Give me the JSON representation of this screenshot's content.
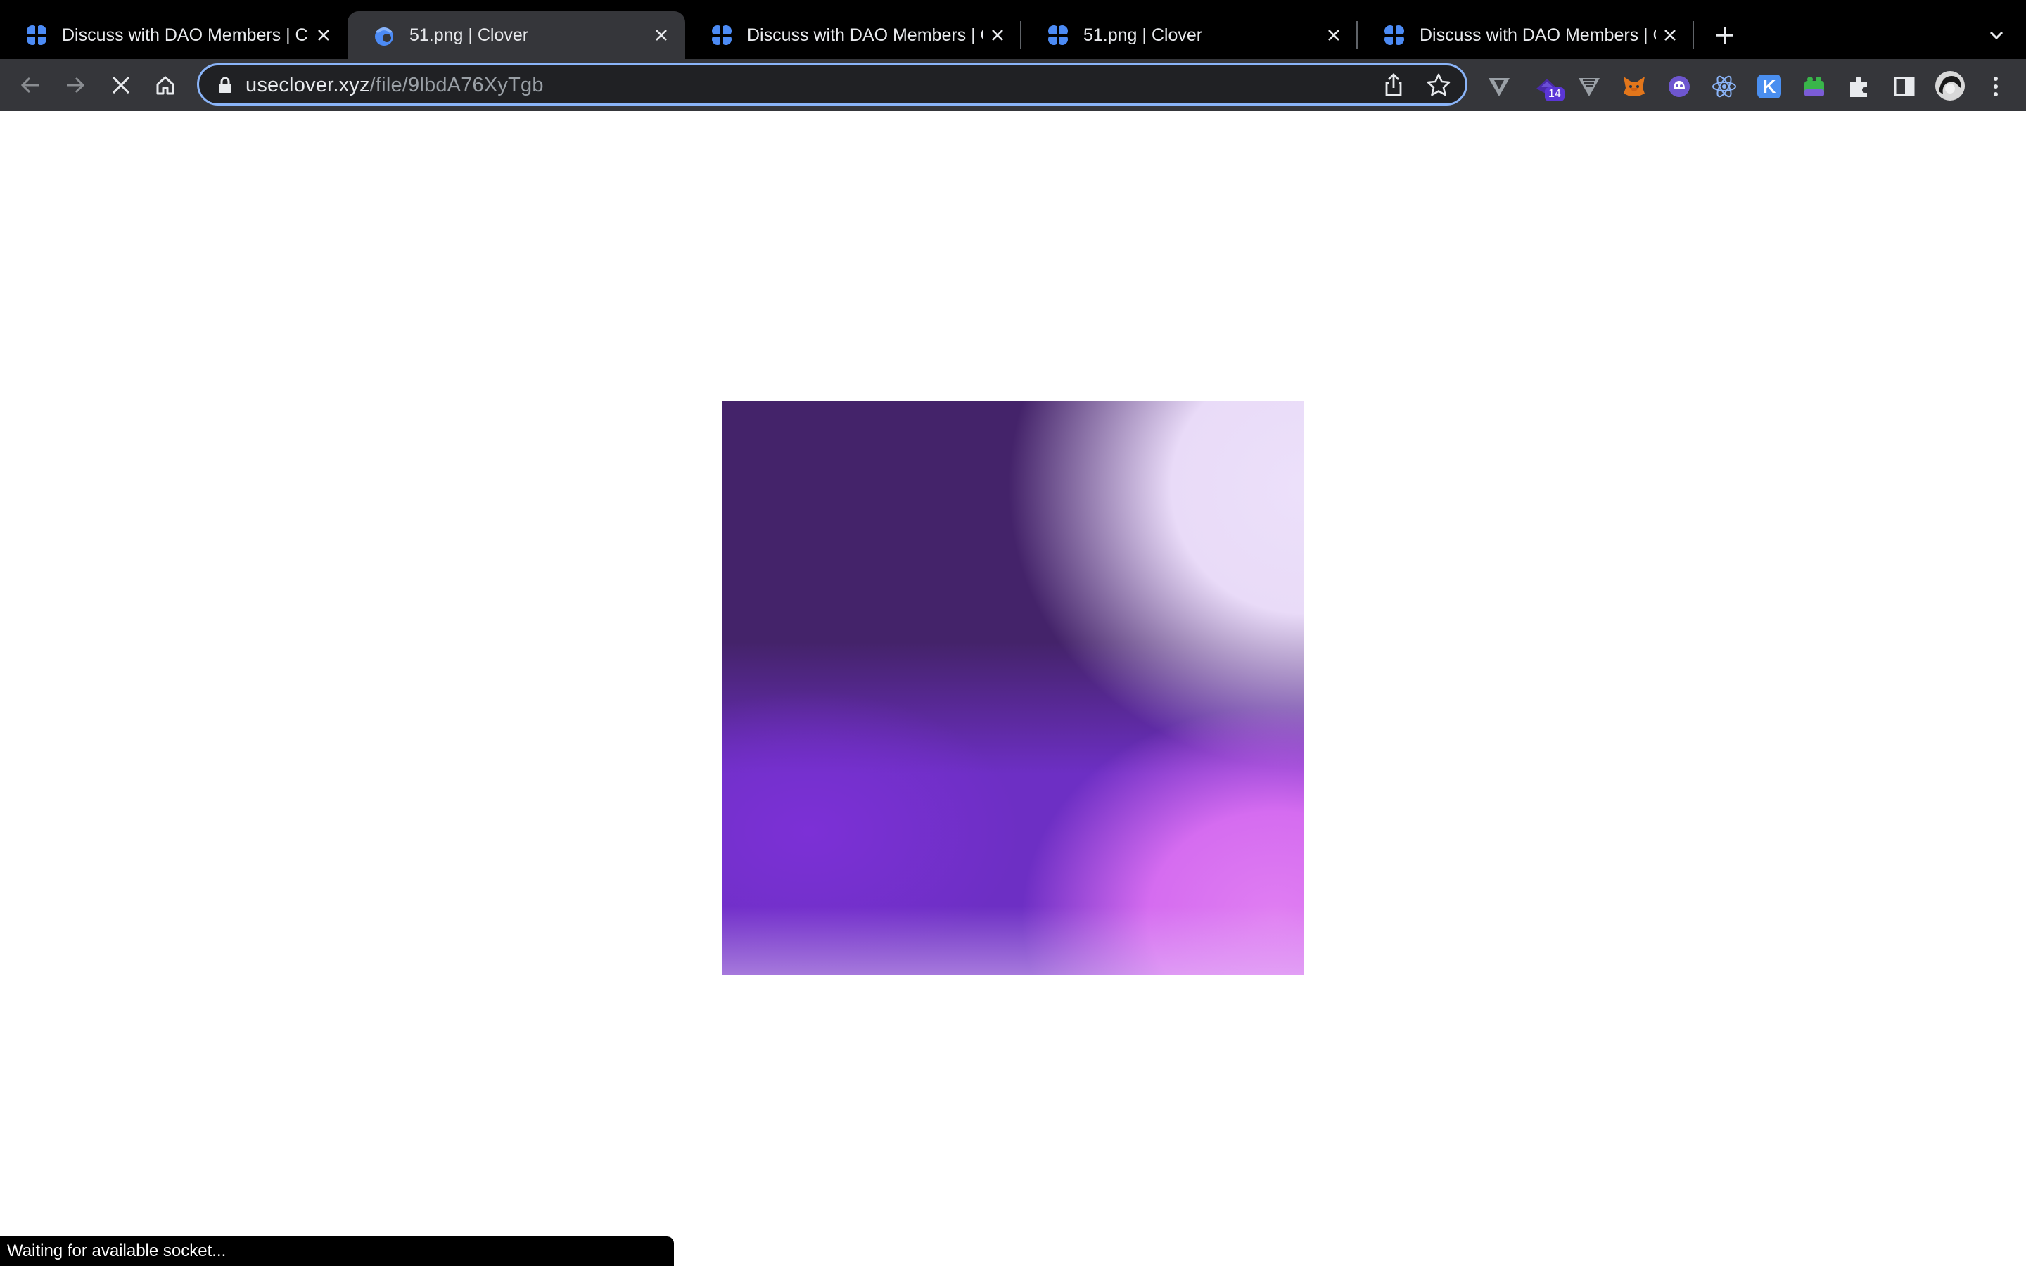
{
  "tabs": [
    {
      "title": "Discuss with DAO Members | C",
      "icon": "clover-icon",
      "active": false
    },
    {
      "title": "51.png | Clover",
      "icon": "clover-blob-icon",
      "active": true
    },
    {
      "title": "Discuss with DAO Members | C",
      "icon": "clover-icon",
      "active": false
    },
    {
      "title": "51.png | Clover",
      "icon": "clover-icon",
      "active": false
    },
    {
      "title": "Discuss with DAO Members | C",
      "icon": "clover-icon",
      "active": false
    }
  ],
  "address_bar": {
    "domain": "useclover.xyz",
    "path": "/file/9lbdA76XyTgb"
  },
  "extensions": [
    {
      "name": "vee-extension-icon"
    },
    {
      "name": "wallet-extension-icon",
      "badge": "14"
    },
    {
      "name": "vee-alt-extension-icon"
    },
    {
      "name": "metamask-fox-icon"
    },
    {
      "name": "ghost-extension-icon"
    },
    {
      "name": "react-devtools-icon"
    },
    {
      "name": "k-extension-icon",
      "letter": "K"
    },
    {
      "name": "green-extension-icon"
    },
    {
      "name": "puzzle-extensions-icon"
    },
    {
      "name": "side-panel-icon"
    },
    {
      "name": "profile-avatar"
    },
    {
      "name": "kebab-menu-icon"
    }
  ],
  "status_bar": {
    "text": "Waiting for available socket..."
  },
  "colors": {
    "tab_strip": "#000000",
    "toolbar": "#35363a",
    "omnibox_focus": "#8ab4f8",
    "art_dark_purple": "#44236a",
    "art_lavender": "#ebdcf9",
    "art_violet": "#7a2fd3",
    "art_pink": "#de74f2"
  }
}
